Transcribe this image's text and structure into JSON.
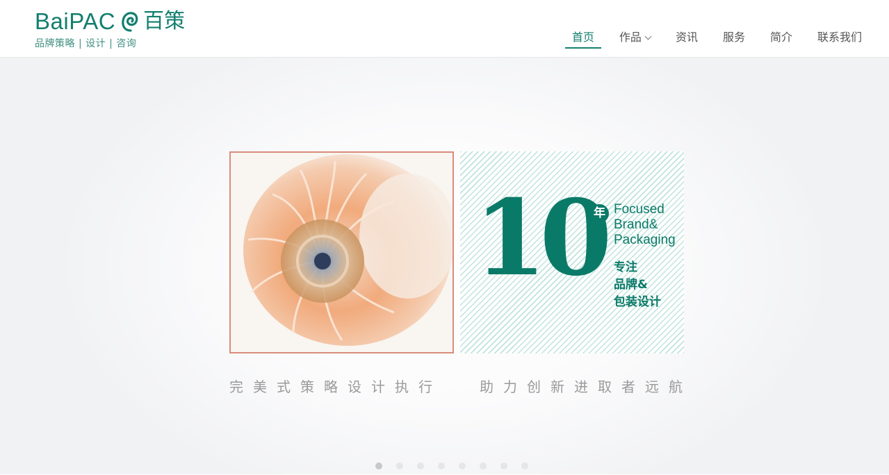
{
  "brand": {
    "name_en": "BaiPAC",
    "name_cn": "百策",
    "tagline": "品牌策略 | 设计 | 咨询",
    "color": "#137f6e"
  },
  "nav": {
    "items": [
      {
        "label": "首页",
        "active": true
      },
      {
        "label": "作品",
        "has_dropdown": true
      },
      {
        "label": "资讯"
      },
      {
        "label": "服务"
      },
      {
        "label": "简介"
      },
      {
        "label": "联系我们"
      }
    ]
  },
  "banner": {
    "photo_icon": "nautilus-shell-image",
    "years": "10",
    "year_char": "年",
    "focus_en": [
      "Focused",
      "Brand&",
      "Packaging"
    ],
    "focus_cn": [
      "专注",
      "品牌&",
      "包装设计"
    ],
    "slogan_left": "完美式策略设计执行",
    "slogan_right": "助力创新进取者远航",
    "accent_color": "#0a7a68",
    "frame_color": "#d98c7a"
  },
  "carousel": {
    "slide_count": 8,
    "active_index": 0
  }
}
